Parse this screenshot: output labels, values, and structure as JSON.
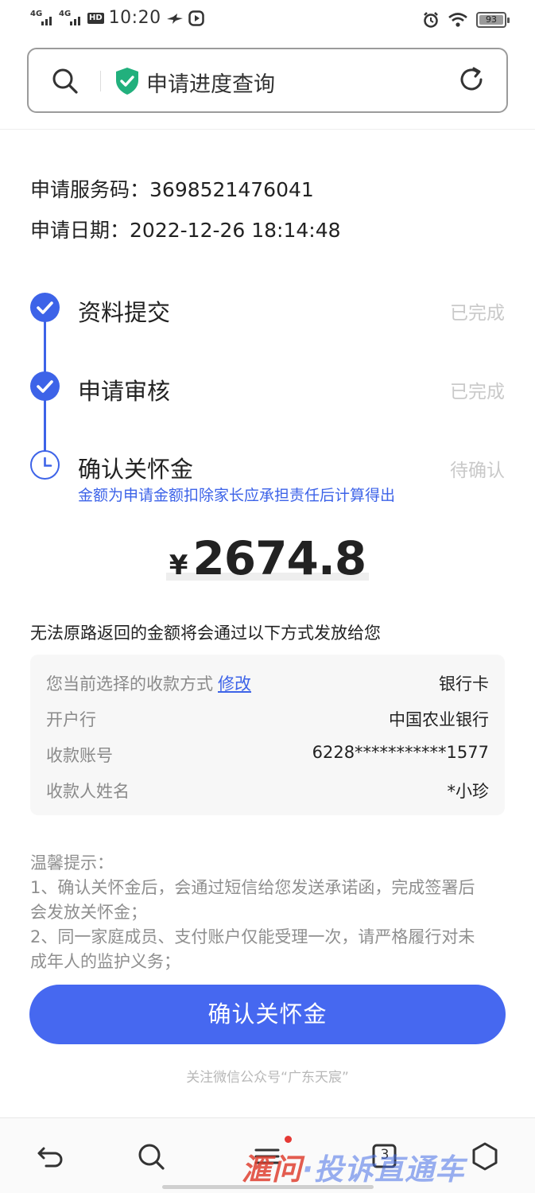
{
  "status_bar": {
    "signal1": "4G",
    "signal2": "4G",
    "hd_badge": "HD",
    "time": "10:20",
    "battery": "93"
  },
  "address_bar": {
    "title": "申请进度查询"
  },
  "application": {
    "service_code_label": "申请服务码：",
    "service_code": "3698521476041",
    "date_label": "申请日期：",
    "date": "2022-12-26 18:14:48"
  },
  "steps": [
    {
      "label": "资料提交",
      "status": "已完成"
    },
    {
      "label": "申请审核",
      "status": "已完成"
    },
    {
      "label": "确认关怀金",
      "status": "待确认"
    }
  ],
  "note": "金额为申请金额扣除家长应承担责任后计算得出",
  "amount": {
    "currency": "¥",
    "value": "2674.8"
  },
  "payout_intro": "无法原路返回的金额将会通过以下方式发放给您",
  "payment": {
    "method_label": "您当前选择的收款方式",
    "edit_label": "修改",
    "method_value": "银行卡",
    "bank_label": "开户行",
    "bank_value": "中国农业银行",
    "account_label": "收款账号",
    "account_value": "6228***********1577",
    "name_label": "收款人姓名",
    "name_value": "*小珍"
  },
  "tips": {
    "title": "温馨提示：",
    "line1": "1、确认关怀金后，会通过短信给您发送承诺函，完成签署后",
    "line1b": "会发放关怀金；",
    "line2": "2、同一家庭成员、支付账户仅能受理一次，请严格履行对未",
    "line2b": "成年人的监护义务；"
  },
  "confirm_button": "确认关怀金",
  "follow_text": "关注微信公众号“广东天宸”",
  "bottom_nav": {
    "tabs_count": "3"
  },
  "watermark": {
    "part1": "滙问",
    "part2": "·投诉直通车"
  },
  "colors": {
    "accent": "#3d63e8",
    "button": "#4668f0",
    "status_done": "#c9c9c9",
    "shield": "#22b07d"
  }
}
